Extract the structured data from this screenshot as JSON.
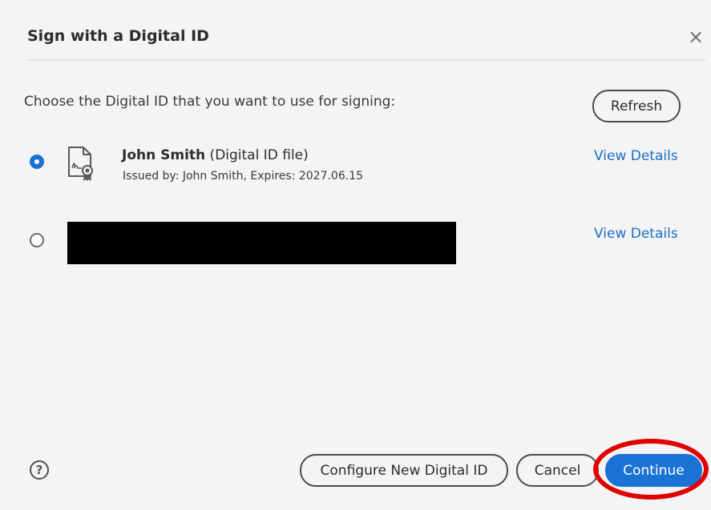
{
  "dialog": {
    "title": "Sign with a Digital ID",
    "close_glyph": "×",
    "prompt": "Choose the Digital ID that you want to use for signing:",
    "refresh_label": "Refresh"
  },
  "ids": [
    {
      "selected": true,
      "icon": "certificate-file-icon",
      "name": "John Smith",
      "type_suffix": " (Digital ID file)",
      "issued": "Issued by: John Smith, Expires: 2027.06.15",
      "details_label": "View Details"
    },
    {
      "selected": false,
      "redacted": true,
      "details_label": "View Details"
    }
  ],
  "footer": {
    "help_glyph": "?",
    "configure_label": "Configure New Digital ID",
    "cancel_label": "Cancel",
    "continue_label": "Continue"
  },
  "colors": {
    "accent": "#1a73d4",
    "link": "#1a6fc4",
    "highlight_ring": "#e10000",
    "background": "#f4f4f4"
  }
}
